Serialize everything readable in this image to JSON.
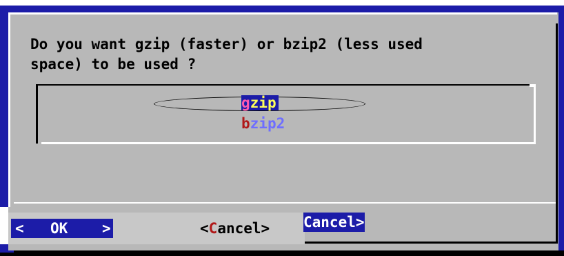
{
  "dialog": {
    "question_line1": "Do you want gzip (faster) or bzip2 (less used",
    "question_line2": "space) to be used ?"
  },
  "list": {
    "items": [
      {
        "hotkey": "g",
        "rest": "zip",
        "selected": true
      },
      {
        "hotkey": "b",
        "rest": "zip2",
        "selected": false
      }
    ]
  },
  "buttons": {
    "ok": {
      "left": "<",
      "label": "OK",
      "right": ">"
    },
    "cancel": {
      "left": "<",
      "hotkey": "C",
      "rest": "ancel",
      "right": ">"
    },
    "cancel_ghost": "Cancel>"
  },
  "colors": {
    "terminal_blue": "#1c1ca8",
    "dialog_gray": "#b8b8b8",
    "selected_text": "#ffff5a",
    "hotkey_red": "#b01818",
    "unselected_item": "#6e6eff"
  }
}
